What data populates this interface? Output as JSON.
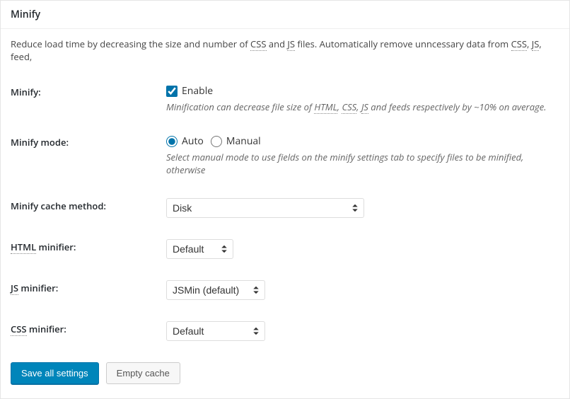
{
  "panel": {
    "title": "Minify"
  },
  "intro": {
    "pre": "Reduce load time by decreasing the size and number of ",
    "abbr1": "CSS",
    "mid1": " and ",
    "abbr2": "JS",
    "mid2": " files. Automatically remove unncessary data from ",
    "abbr3": "CSS",
    "mid3": ", ",
    "abbr4": "JS",
    "post": ", feed,"
  },
  "minify": {
    "label": "Minify:",
    "checkbox_label": "Enable",
    "checked": true,
    "desc_pre": "Minification can decrease file size of ",
    "desc_a1": "HTML",
    "desc_m1": ", ",
    "desc_a2": "CSS",
    "desc_m2": ", ",
    "desc_a3": "JS",
    "desc_post": " and feeds respectively by ~10% on average."
  },
  "mode": {
    "label": "Minify mode:",
    "auto_label": "Auto",
    "manual_label": "Manual",
    "selected": "auto",
    "desc": "Select manual mode to use fields on the minify settings tab to specify files to be minified, otherwise "
  },
  "cache_method": {
    "label": "Minify cache method:",
    "value": "Disk"
  },
  "html_minifier": {
    "label_abbr": "HTML",
    "label_post": " minifier:",
    "value": "Default"
  },
  "js_minifier": {
    "label_abbr": "JS",
    "label_post": " minifier:",
    "value": "JSMin (default)"
  },
  "css_minifier": {
    "label_abbr": "CSS",
    "label_post": " minifier:",
    "value": "Default"
  },
  "buttons": {
    "save": "Save all settings",
    "empty": "Empty cache"
  }
}
